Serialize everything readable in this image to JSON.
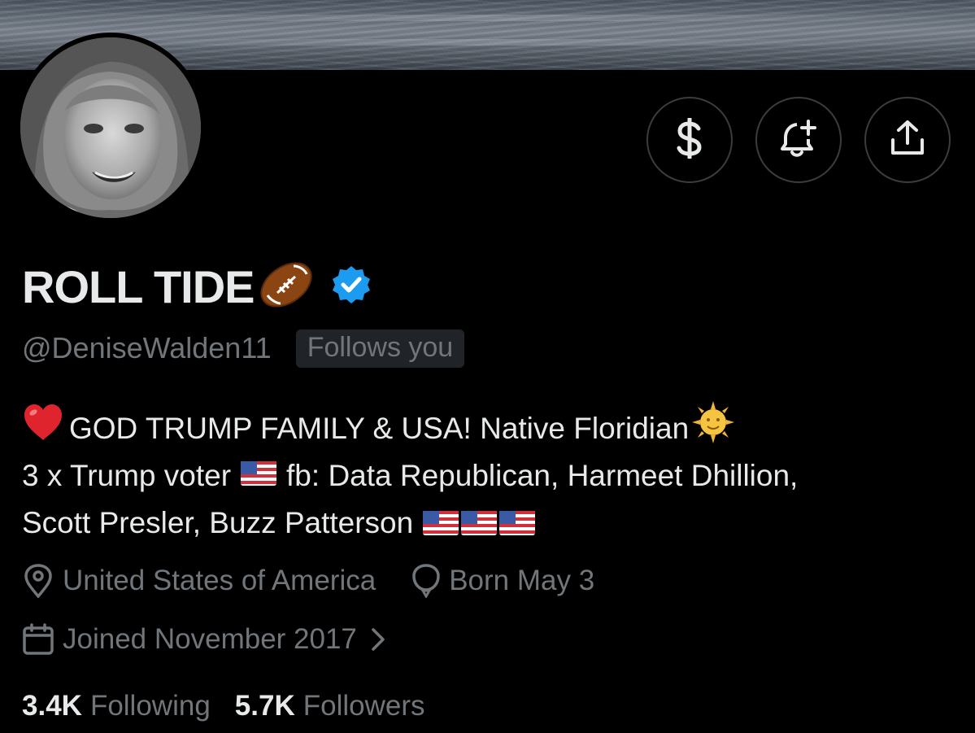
{
  "profile": {
    "display_name": "ROLL TIDE",
    "name_emoji": "football-emoji",
    "verified_badge": "blue-check-verified-icon",
    "handle": "@DeniseWalden11",
    "follows_you": "Follows you"
  },
  "actions": {
    "tip_icon": "dollar-sign-icon",
    "notify_icon": "bell-plus-icon",
    "share_icon": "share-upload-icon"
  },
  "bio": {
    "line1_text": "GOD TRUMP FAMILY & USA! Native Floridian",
    "line2_text_a": "3 x Trump voter",
    "line2_text_b": "fb: Data Republican, Harmeet Dhillion,",
    "line3_text": "Scott Presler, Buzz Patterson"
  },
  "meta": {
    "location": "United States of America",
    "birthday": "Born May 3",
    "joined": "Joined November 2017"
  },
  "stats": {
    "following_count": "3.4K",
    "following_label": "Following",
    "followers_count": "5.7K",
    "followers_label": "Followers"
  },
  "colors": {
    "background": "#000000",
    "primary_text": "#e7e9ea",
    "secondary_text": "#71767b",
    "verified_blue": "#1d9bf0",
    "button_border": "#3a3d40"
  }
}
